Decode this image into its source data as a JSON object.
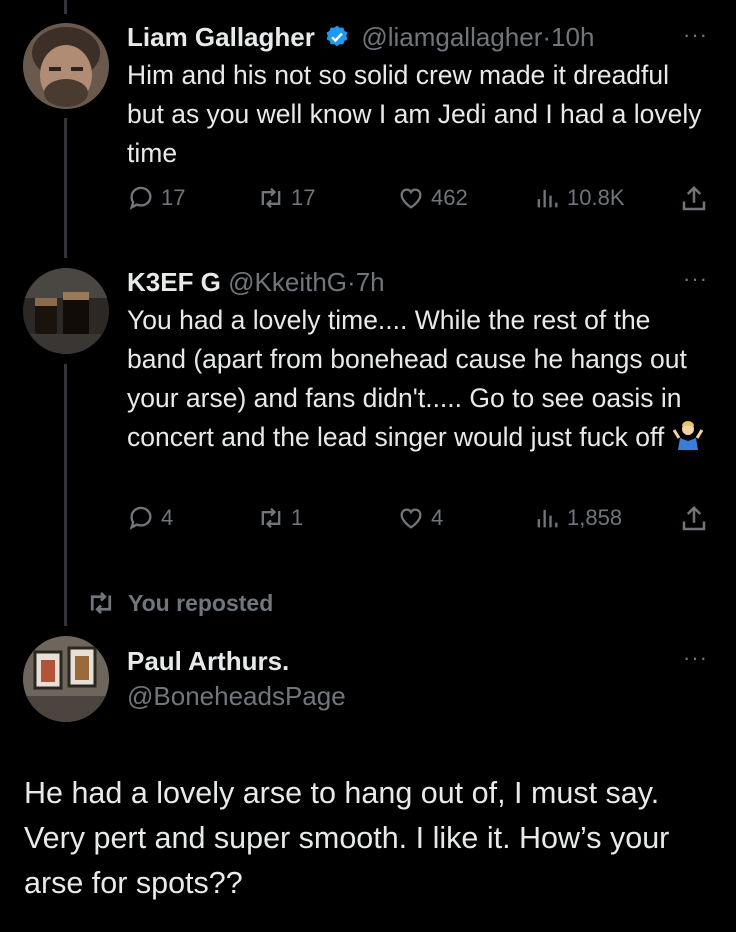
{
  "tweets": [
    {
      "name": "Liam Gallagher",
      "handle": "@liamgallagher",
      "time": "10h",
      "text": "Him and his not so solid crew made it dreadful but as you well know I am Jedi and I had a lovely time",
      "replies": "17",
      "reposts": "17",
      "likes": "462",
      "views": "10.8K"
    },
    {
      "name": "K3EF G",
      "handle": "@KkeithG",
      "time": "7h",
      "text": "You had a lovely time.... While the rest of the band (apart from bonehead cause he hangs out your arse) and fans didn't..... Go to see oasis in concert and the lead singer would just fuck off",
      "replies": "4",
      "reposts": "1",
      "likes": "4",
      "views": "1,858"
    },
    {
      "name": "Paul Arthurs.",
      "handle": "@BoneheadsPage",
      "text": "He had a lovely arse to hang out of, I must say. Very pert and super smooth. I like it. How’s your arse for spots??"
    }
  ],
  "repost_note": "You reposted",
  "more_label": "···",
  "separator": "·",
  "colors": {
    "background": "#000000",
    "text": "#e7e9ea",
    "muted": "#71767b",
    "verified": "#1d9bf0"
  },
  "icons": [
    "reply-icon",
    "repost-icon",
    "like-icon",
    "views-icon",
    "share-icon",
    "verified-badge-icon",
    "shrug-emoji"
  ]
}
